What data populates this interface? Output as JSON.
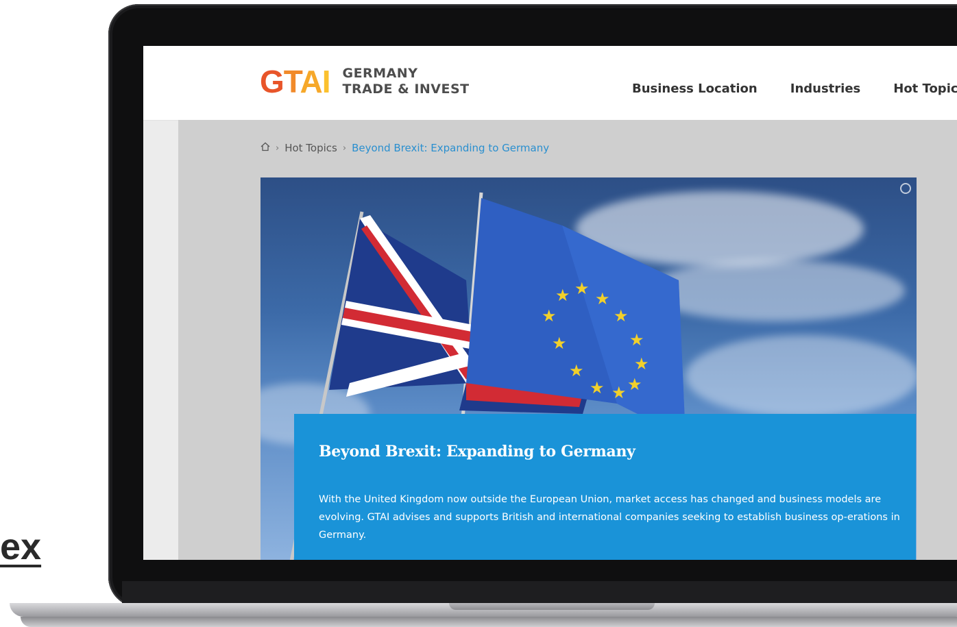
{
  "side_word": "ex",
  "logo": {
    "mark": [
      "G",
      "T",
      "A",
      "I"
    ],
    "line1": "GERMANY",
    "line2": "TRADE & INVEST"
  },
  "nav": {
    "items": [
      "Business Location",
      "Industries",
      "Hot Topics"
    ]
  },
  "breadcrumb": {
    "home_icon": "home-icon",
    "items": [
      "Hot Topics",
      "Beyond Brexit: Expanding to Germany"
    ]
  },
  "hero": {
    "image": "uk-and-eu-flags",
    "caption_icon": "copyright-icon"
  },
  "article": {
    "title": "Beyond Brexit: Expanding to Germany",
    "intro": "With the United Kingdom now outside the European Union, market access has changed and business models are evolving. GTAI advises and supports British and international companies seeking to establish business op-erations in Germany."
  },
  "colors": {
    "accent": "#1a93d8",
    "link": "#2a8fcf"
  }
}
